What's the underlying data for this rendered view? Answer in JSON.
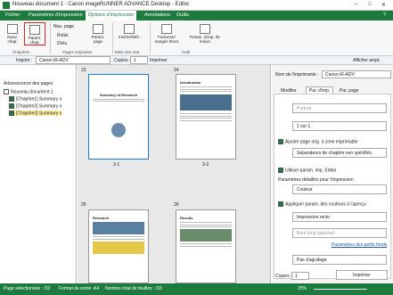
{
  "app": {
    "title": "Nouveau document 1 - Canon imageRUNNER ADVANCE Desktop - Editor",
    "title_buttons": [
      "–",
      "□",
      "✕"
    ]
  },
  "menu": {
    "tabs": [
      "Fichier",
      "Paramètres d'impression",
      "Options d'impression",
      "Annotations",
      "Outils"
    ],
    "help": "?"
  },
  "ribbon": {
    "new_chapter": "Nouv. chap.",
    "chapter_params": "Param. chap.",
    "new_page": "Nou. page",
    "rotate": "Rotat.",
    "divide": "Divis.",
    "page_params": "Param. page",
    "insert_table": "Insérer/Mél.",
    "merge": "Fusionner",
    "merge_blocks": "Fusionner marges blocs",
    "print_params": "Param. d'imp. de fusion",
    "groups": [
      "Chapitres",
      "Pages originales",
      "Table des mat.",
      "Outil"
    ]
  },
  "toolbar": {
    "printer_label": "Imprim :",
    "printer_value": "Canon iR-ADV",
    "copies_label": "Copies :",
    "copies_value": "1",
    "print_button": "Imprimer",
    "show_settings": "Afficher ampt."
  },
  "left": {
    "header": "Arborescence des pages",
    "root": "Nouveau document 1",
    "items": [
      "[Chapitre1] Summary o",
      "[Chapitre2] Summary o",
      "[Chapitre3] Summary o"
    ]
  },
  "pages": [
    {
      "num": "23",
      "label": "3-1",
      "title": "Summary of Research"
    },
    {
      "num": "24",
      "label": "3-2",
      "title": "Introduction"
    },
    {
      "num": "25",
      "label": "",
      "title": "Research"
    },
    {
      "num": "26",
      "label": "",
      "title": "Results"
    }
  ],
  "right": {
    "printer_name_label": "Nom de l'imprimante :",
    "printer_name": "Canon iR-ADV",
    "tabs": [
      "Modifier",
      "Par. d'imp.",
      "Par. page"
    ],
    "orientation": "Portrait",
    "layout": "1 sur 1",
    "fit_label": "Ajuster page orig. à zone imprimable",
    "separator": "Séparateurs de chapitre non spécifiés",
    "use_editor": "Utiliser param. imp. Editor",
    "detail_header": "Paramètres détaillés pour l'impression",
    "color": "Couleur",
    "apply_label": "Appliquer param. des couleurs à l'aperçu",
    "duplex": "Impression recto",
    "edge": "Bord long (gauche)",
    "small_stamp": "Paramètres des petits fonds",
    "staple": "Pas d'agrafage",
    "copies_label": "Copies :",
    "copies": "1",
    "print": "Imprimer"
  },
  "status": {
    "selected": "Page sélectionnée : /33",
    "format": "Format de sortie :A4",
    "sheets": "Nombre total de feuilles : /33",
    "zoom": "25%"
  },
  "colors": {
    "accent": "#1e7b3e",
    "highlight": "#e8b400"
  }
}
